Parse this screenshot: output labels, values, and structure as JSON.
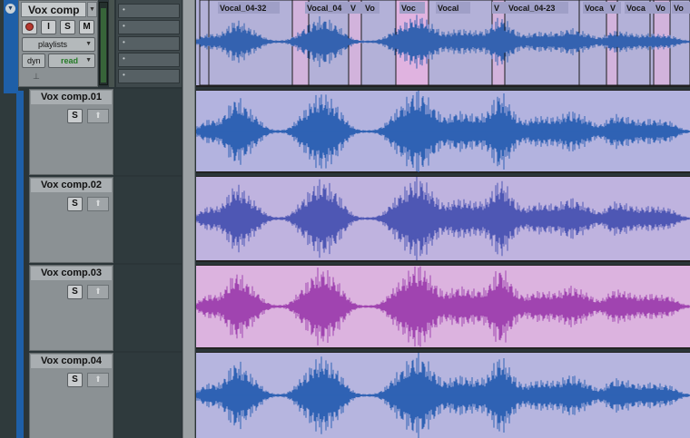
{
  "parent_track": {
    "name": "Vox comp",
    "record_label": "",
    "input_label": "I",
    "solo_label": "S",
    "mute_label": "M",
    "playlists_label": "playlists",
    "view_label": "dyn",
    "automation_mode": "read"
  },
  "child_tracks": [
    {
      "name": "Vox comp.01",
      "solo_label": "S",
      "lane_color": "#b3b3df",
      "wave_color": "#2f62b4"
    },
    {
      "name": "Vox comp.02",
      "solo_label": "S",
      "lane_color": "#bfb3df",
      "wave_color": "#4e57b4"
    },
    {
      "name": "Vox comp.03",
      "solo_label": "S",
      "lane_color": "#dcb3df",
      "wave_color": "#a044b0"
    },
    {
      "name": "Vox comp.04",
      "solo_label": "S",
      "lane_color": "#b6b5df",
      "wave_color": "#2f62b4"
    }
  ],
  "parent_clips": [
    {
      "label": "Vocal_04-32"
    },
    {
      "label": "Vocal_04"
    },
    {
      "label": "V"
    },
    {
      "label": "Vo"
    },
    {
      "label": "Voc"
    },
    {
      "label": "Vocal"
    },
    {
      "label": "V"
    },
    {
      "label": "Vocal_04-23"
    },
    {
      "label": "Voca"
    },
    {
      "label": "V"
    },
    {
      "label": "Voca"
    },
    {
      "label": "Vo"
    },
    {
      "label": "Vo"
    }
  ],
  "icons": {
    "disclosure": "triangle-down-icon",
    "track_info": "info-icon",
    "arrow": "up-arrow-icon"
  },
  "colors": {
    "accent_blue": "#1e5fa8",
    "record_red": "#b6382f",
    "automation_green": "#247a25"
  }
}
